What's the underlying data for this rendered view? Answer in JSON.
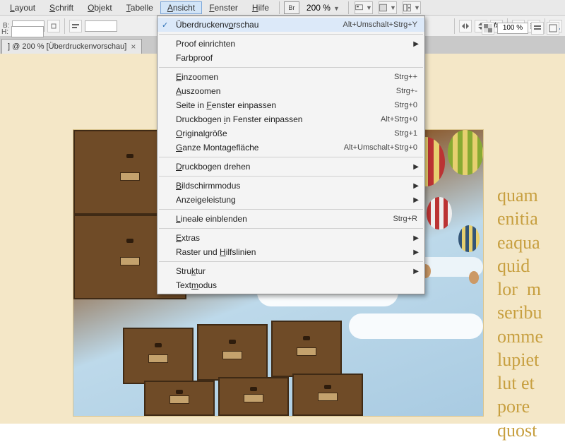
{
  "menubar": {
    "items": [
      {
        "label": "Layout",
        "u": 0
      },
      {
        "label": "Schrift",
        "u": 0
      },
      {
        "label": "Objekt",
        "u": 0
      },
      {
        "label": "Tabelle",
        "u": 0
      },
      {
        "label": "Ansicht",
        "u": 0,
        "active": true
      },
      {
        "label": "Fenster",
        "u": 0
      },
      {
        "label": "Hilfe",
        "u": 0
      }
    ],
    "br_label": "Br",
    "zoom": "200 %"
  },
  "toolbar2": {
    "b_label": "B:",
    "h_label": "H:",
    "opacity": "100 %"
  },
  "tab": {
    "title": "] @ 200 % [Überdruckenvorschau]"
  },
  "dropdown": {
    "items": [
      {
        "label": "Überdruckenvorschau",
        "u": 12,
        "shortcut": "Alt+Umschalt+Strg+Y",
        "checked": true
      },
      {
        "sep": true
      },
      {
        "label": "Proof einrichten",
        "sub": true
      },
      {
        "label": "Farbproof"
      },
      {
        "sep": true
      },
      {
        "label": "Einzoomen",
        "u": 0,
        "shortcut": "Strg++"
      },
      {
        "label": "Auszoomen",
        "u": 0,
        "shortcut": "Strg+-"
      },
      {
        "label": "Seite in Fenster einpassen",
        "u": 9,
        "shortcut": "Strg+0"
      },
      {
        "label": "Druckbogen in Fenster einpassen",
        "u": 11,
        "shortcut": "Alt+Strg+0"
      },
      {
        "label": "Originalgröße",
        "u": 0,
        "shortcut": "Strg+1"
      },
      {
        "label": "Ganze Montagefläche",
        "u": 0,
        "shortcut": "Alt+Umschalt+Strg+0"
      },
      {
        "sep": true
      },
      {
        "label": "Druckbogen drehen",
        "u": 0,
        "sub": true
      },
      {
        "sep": true
      },
      {
        "label": "Bildschirmmodus",
        "u": 0,
        "sub": true
      },
      {
        "label": "Anzeigeleistung",
        "sub": true
      },
      {
        "sep": true
      },
      {
        "label": "Lineale einblenden",
        "u": 0,
        "shortcut": "Strg+R"
      },
      {
        "sep": true
      },
      {
        "label": "Extras",
        "u": 0,
        "sub": true
      },
      {
        "label": "Raster und Hilfslinien",
        "u": 11,
        "sub": true
      },
      {
        "sep": true
      },
      {
        "label": "Struktur",
        "u": 4,
        "sub": true
      },
      {
        "label": "Textmodus",
        "u": 4
      }
    ]
  },
  "lorem": "quam\nenitia\neaqua\nquid\nlor  m\nseribu\nomme\nlupiet\nlut et\npore\nquost"
}
